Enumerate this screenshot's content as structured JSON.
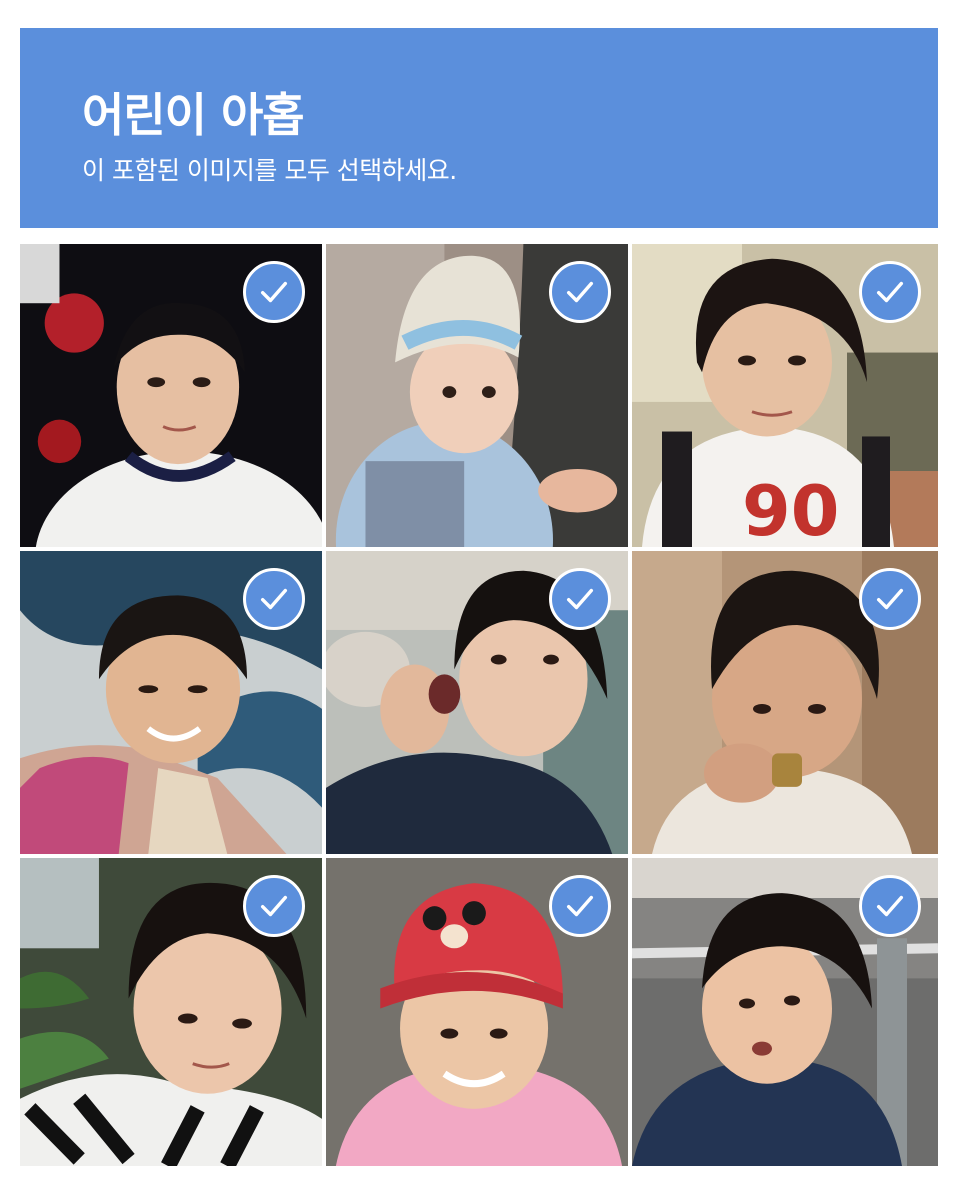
{
  "header": {
    "title": "어린이 아홉",
    "subtitle": "이 포함된 이미지를 모두 선택하세요."
  },
  "colors": {
    "accent": "#5b8fdc",
    "check": "#ffffff"
  },
  "tiles": [
    {
      "selected": true,
      "icon": "checkmark-icon"
    },
    {
      "selected": true,
      "icon": "checkmark-icon"
    },
    {
      "selected": true,
      "icon": "checkmark-icon"
    },
    {
      "selected": true,
      "icon": "checkmark-icon"
    },
    {
      "selected": true,
      "icon": "checkmark-icon"
    },
    {
      "selected": true,
      "icon": "checkmark-icon"
    },
    {
      "selected": true,
      "icon": "checkmark-icon"
    },
    {
      "selected": true,
      "icon": "checkmark-icon"
    },
    {
      "selected": true,
      "icon": "checkmark-icon"
    }
  ]
}
